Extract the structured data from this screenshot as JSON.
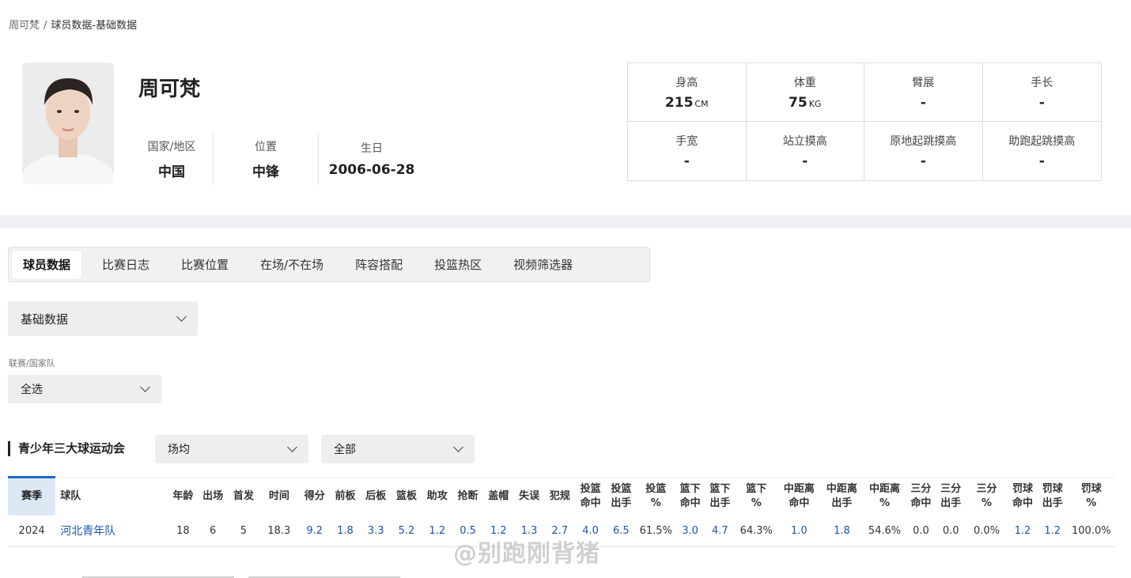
{
  "breadcrumb": {
    "first": "周可梵",
    "separator": "/",
    "current": "球员数据-基础数据"
  },
  "player": {
    "name": "周可梵",
    "info": [
      {
        "label": "国家/地区",
        "value": "中国"
      },
      {
        "label": "位置",
        "value": "中锋"
      },
      {
        "label": "生日",
        "value": "2006-06-28"
      }
    ]
  },
  "measurements": [
    {
      "label": "身高",
      "value": "215",
      "unit": "CM"
    },
    {
      "label": "体重",
      "value": "75",
      "unit": "KG"
    },
    {
      "label": "臂展",
      "value": "-",
      "unit": ""
    },
    {
      "label": "手长",
      "value": "-",
      "unit": ""
    },
    {
      "label": "手宽",
      "value": "-",
      "unit": ""
    },
    {
      "label": "站立摸高",
      "value": "-",
      "unit": ""
    },
    {
      "label": "原地起跳摸高",
      "value": "-",
      "unit": ""
    },
    {
      "label": "助跑起跳摸高",
      "value": "-",
      "unit": ""
    }
  ],
  "tabs": [
    "球员数据",
    "比赛日志",
    "比赛位置",
    "在场/不在场",
    "阵容搭配",
    "投篮热区",
    "视频筛选器"
  ],
  "active_tab": "球员数据",
  "data_type_select": {
    "value": "基础数据"
  },
  "league_filter": {
    "label": "联赛/国家队",
    "value": "全选"
  },
  "section": {
    "title": "青少年三大球运动会",
    "mode_select": "场均",
    "scope_select": "全部"
  },
  "table": {
    "headers": [
      "赛季",
      "球队",
      "年龄",
      "出场",
      "首发",
      "时间",
      "得分",
      "前板",
      "后板",
      "篮板",
      "助攻",
      "抢断",
      "盖帽",
      "失误",
      "犯规",
      "投篮\n命中",
      "投篮\n出手",
      "投篮\n%",
      "篮下\n命中",
      "篮下\n出手",
      "篮下\n%",
      "中距离\n命中",
      "中距离\n出手",
      "中距离\n%",
      "三分\n命中",
      "三分\n出手",
      "三分\n%",
      "罚球\n命中",
      "罚球\n出手",
      "罚球\n%"
    ],
    "rows": [
      [
        "2024",
        "河北青年队",
        "18",
        "6",
        "5",
        "18.3",
        "9.2",
        "1.8",
        "3.3",
        "5.2",
        "1.2",
        "0.5",
        "1.2",
        "1.3",
        "2.7",
        "4.0",
        "6.5",
        "61.5%",
        "3.0",
        "4.7",
        "64.3%",
        "1.0",
        "1.8",
        "54.6%",
        "0.0",
        "0.0",
        "0.0%",
        "1.2",
        "1.2",
        "100.0%"
      ]
    ]
  },
  "watermark": "@别跑刚背猪",
  "colors": {
    "accent": "#1a66c9",
    "link": "#1a55b0",
    "band": "#eef0f4",
    "select_bg": "#eeeeee"
  }
}
